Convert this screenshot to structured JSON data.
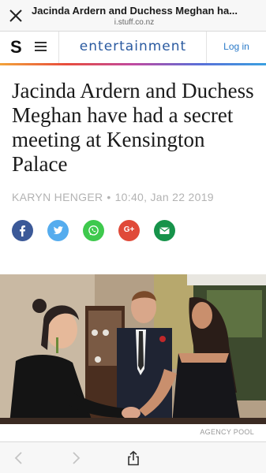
{
  "browser": {
    "page_title": "Jacinda Ardern and Duchess Meghan ha...",
    "url": "i.stuff.co.nz",
    "close_icon": "close-icon"
  },
  "site": {
    "logo": "S",
    "section": "entertainment",
    "login": "Log in"
  },
  "article": {
    "headline": "Jacinda Ardern and Duchess Meghan have had a secret meeting at Kensington Palace",
    "author": "Karyn Henger",
    "separator": "•",
    "timestamp": "10:40, Jan 22 2019",
    "photo_credit": "AGENCY POOL"
  },
  "share": {
    "google_plus_label": "G+",
    "icons": [
      "facebook-icon",
      "twitter-icon",
      "whatsapp-icon",
      "google-plus-icon",
      "email-icon"
    ]
  },
  "colors": {
    "section_title": "#2a5aa0",
    "login": "#2a7ac9",
    "facebook": "#3b5998",
    "twitter": "#55acee",
    "whatsapp": "#3ec94d",
    "google_plus": "#e04a39",
    "email": "#16934a"
  }
}
